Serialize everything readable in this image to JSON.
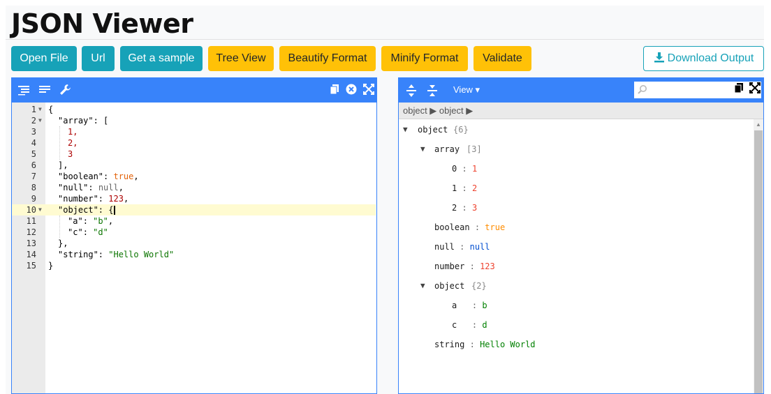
{
  "app": {
    "title": "JSON Viewer"
  },
  "toolbar": {
    "open_file": "Open File",
    "url": "Url",
    "get_sample": "Get a sample",
    "tree_view": "Tree View",
    "beautify": "Beautify Format",
    "minify": "Minify Format",
    "validate": "Validate",
    "download": "Download Output"
  },
  "editor": {
    "lines": [
      {
        "n": "1",
        "fold": true
      },
      {
        "n": "2",
        "fold": true
      },
      {
        "n": "3"
      },
      {
        "n": "4"
      },
      {
        "n": "5"
      },
      {
        "n": "6"
      },
      {
        "n": "7"
      },
      {
        "n": "8"
      },
      {
        "n": "9"
      },
      {
        "n": "10",
        "fold": true
      },
      {
        "n": "11"
      },
      {
        "n": "12"
      },
      {
        "n": "13"
      },
      {
        "n": "14"
      },
      {
        "n": "15"
      }
    ],
    "text": {
      "l1": "{",
      "l2_key": "\"array\"",
      "l2_rest": ": [",
      "l3": "1,",
      "l4": "2,",
      "l5": "3",
      "l6": "],",
      "l7_key": "\"boolean\"",
      "l7_val": "true",
      "l7_end": ",",
      "l8_key": "\"null\"",
      "l8_val": "null",
      "l8_end": ",",
      "l9_key": "\"number\"",
      "l9_val": "123",
      "l9_end": ",",
      "l10_key": "\"object\"",
      "l10_rest": ": {",
      "l11_key": "\"a\"",
      "l11_val": "\"b\"",
      "l11_end": ",",
      "l12_key": "\"c\"",
      "l12_val": "\"d\"",
      "l13": "},",
      "l14_key": "\"string\"",
      "l14_val": "\"Hello World\"",
      "l15": "}",
      "colon": ": "
    }
  },
  "viewer": {
    "view_menu": "View ▾",
    "search_placeholder": "",
    "breadcrumb": "object ▶ object ▶",
    "tree": {
      "root_key": "object",
      "root_count": "{6}",
      "array_key": "array",
      "array_count": "[3]",
      "items": [
        {
          "k": "0",
          "v": "1"
        },
        {
          "k": "1",
          "v": "2"
        },
        {
          "k": "2",
          "v": "3"
        }
      ],
      "boolean_key": "boolean",
      "boolean_val": "true",
      "null_key": "null",
      "null_val": "null",
      "number_key": "number",
      "number_val": "123",
      "object_key": "object",
      "object_count": "{2}",
      "a_key": "a",
      "a_val": "b",
      "c_key": "c",
      "c_val": "d",
      "string_key": "string",
      "string_val": "Hello World",
      "sep": ":"
    }
  },
  "colors": {
    "accent": "#3883fa",
    "teal": "#17a2b8",
    "yellow": "#ffc107"
  }
}
